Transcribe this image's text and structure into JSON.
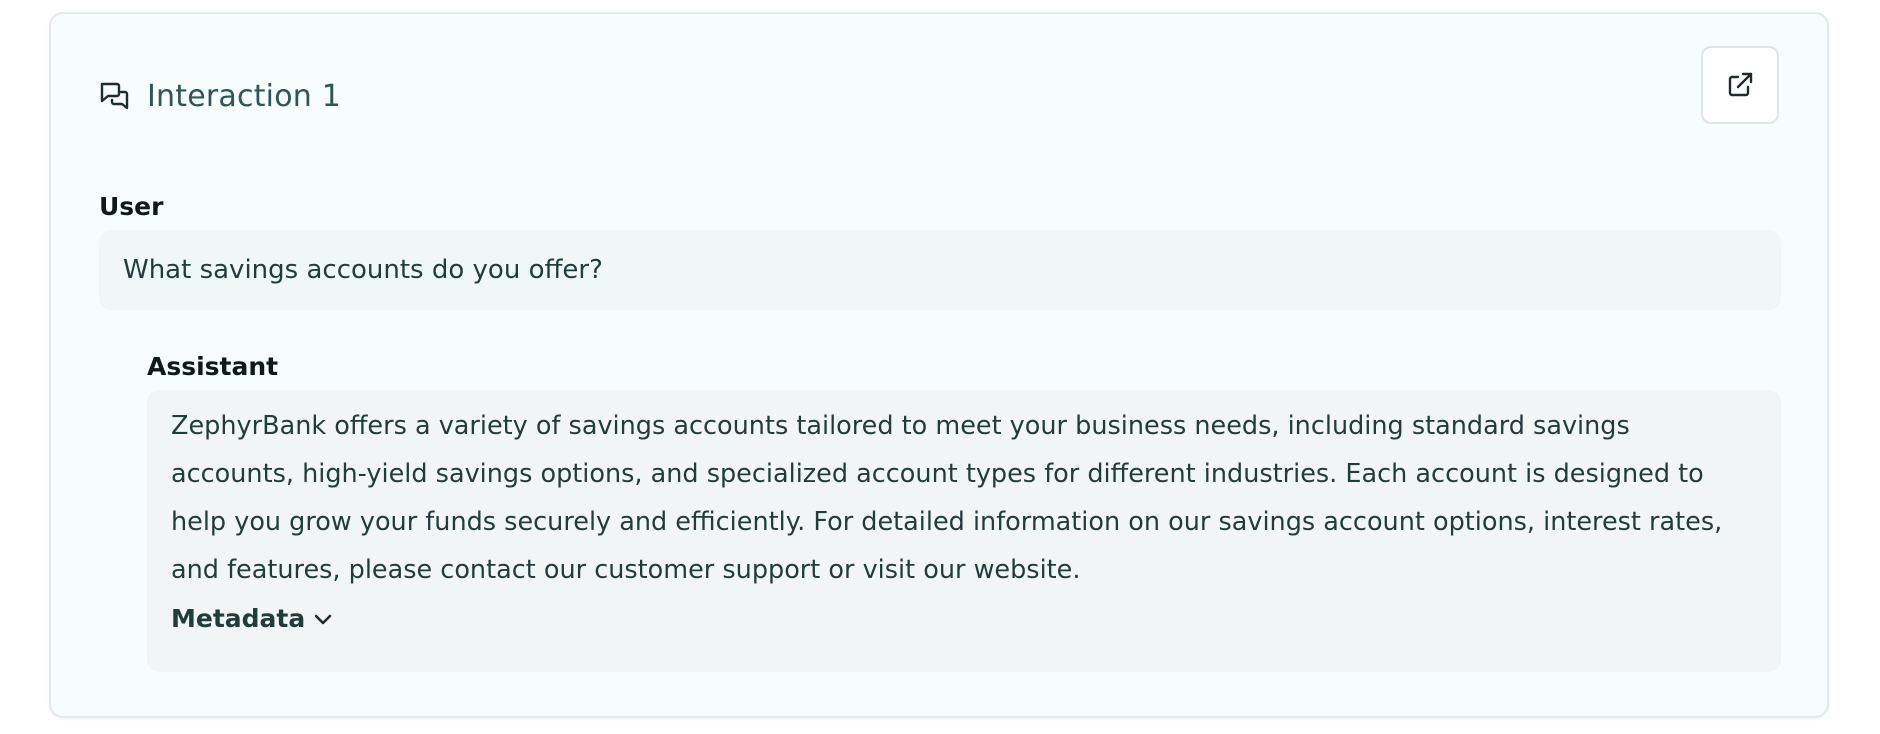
{
  "interaction": {
    "title": "Interaction 1",
    "icons": {
      "header": "chat-bubbles-icon",
      "open": "external-link-icon",
      "metadata": "chevron-down-icon"
    }
  },
  "user": {
    "label": "User",
    "message": "What savings accounts do you offer?"
  },
  "assistant": {
    "label": "Assistant",
    "message": "ZephyrBank offers a variety of savings accounts tailored to meet your business needs, including standard savings accounts, high-yield savings options, and specialized account types for different industries. Each account is designed to help you grow your funds securely and efficiently. For detailed information on our savings account options, interest rates, and features, please contact our customer support or visit our website.",
    "metadata_label": "Metadata"
  },
  "colors": {
    "card_bg": "#f7fcfc",
    "user_bubble": "#eff7f7",
    "assistant_bubble": "#f2f5f6",
    "title_text": "#2d5754"
  }
}
